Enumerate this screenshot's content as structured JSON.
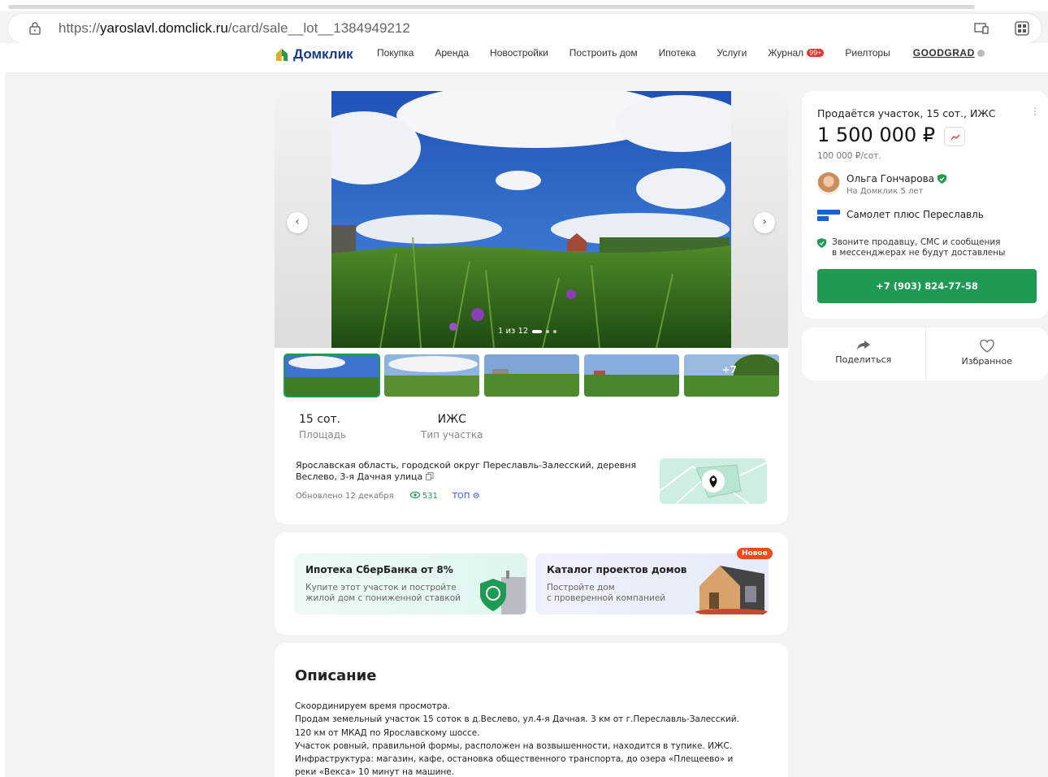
{
  "browser": {
    "url_prefix": "https://",
    "url_host": "yaroslavl.domclick.ru",
    "url_path": "/card/sale__lot__1384949212"
  },
  "header": {
    "logo": "Домклик",
    "nav": [
      "Покупка",
      "Аренда",
      "Новостройки",
      "Построить дом",
      "Ипотека",
      "Услуги",
      "Журнал",
      "Риелторы"
    ],
    "journal_badge": "99+",
    "partner": "GOODGRAD"
  },
  "gallery": {
    "counter": "1 из 12",
    "more_photos": "+7"
  },
  "facts": [
    {
      "value": "15 сот.",
      "label": "Площадь"
    },
    {
      "value": "ИЖС",
      "label": "Тип участка"
    }
  ],
  "address": "Ярославская область, городской округ Переславль-Залесский, деревня Веслево, 3-я Дачная улица",
  "meta": {
    "updated": "Обновлено 12 декабря",
    "views": "531",
    "top": "ТОП"
  },
  "promos": [
    {
      "title": "Ипотека СберБанка от 8%",
      "sub1": "Купите этот участок и постройте",
      "sub2": "жилой дом с пониженной ставкой"
    },
    {
      "title": "Каталог проектов домов",
      "sub1": "Постройте дом",
      "sub2": "с проверенной компанией",
      "badge": "Новое"
    }
  ],
  "description": {
    "title": "Описание",
    "lines": [
      "Скоординируем время просмотра.",
      "Продам земельный участок 15 соток в д.Веслево, ул.4-я Дачная. 3 км от г.Переславль-Залесский.",
      "120 км от МКАД по Ярославскому шоссе.",
      "Участок ровный, правильной формы, расположен на возвышенности, находится в тупике. ИЖС.",
      "Инфраструктура: магазин, кафе, остановка общественного транспорта, до озера «Плещеево» и",
      "реки «Векса» 10 минут на машине."
    ]
  },
  "offer": {
    "title": "Продаётся участок, 15 сот., ИЖС",
    "price": "1 500 000 ₽",
    "price_per_unit": "100 000 ₽/сот.",
    "seller_name": "Ольга Гончарова",
    "seller_sub": "На Домклик 5 лет",
    "agency": "Самолет плюс Переславль",
    "warning1": "Звоните продавцу, СМС и сообщения",
    "warning2": "в мессенджерах не будут доставлены",
    "phone": "+7 (903) 824-77-58"
  },
  "actions": {
    "share": "Поделиться",
    "favorite": "Избранное"
  },
  "colors": {
    "brand_green": "#1e9a52",
    "brand_blue": "#1a3a8a",
    "badge_red": "#e8312f",
    "new_badge": "#ef4a1c",
    "top_blue": "#2b5bdc"
  }
}
